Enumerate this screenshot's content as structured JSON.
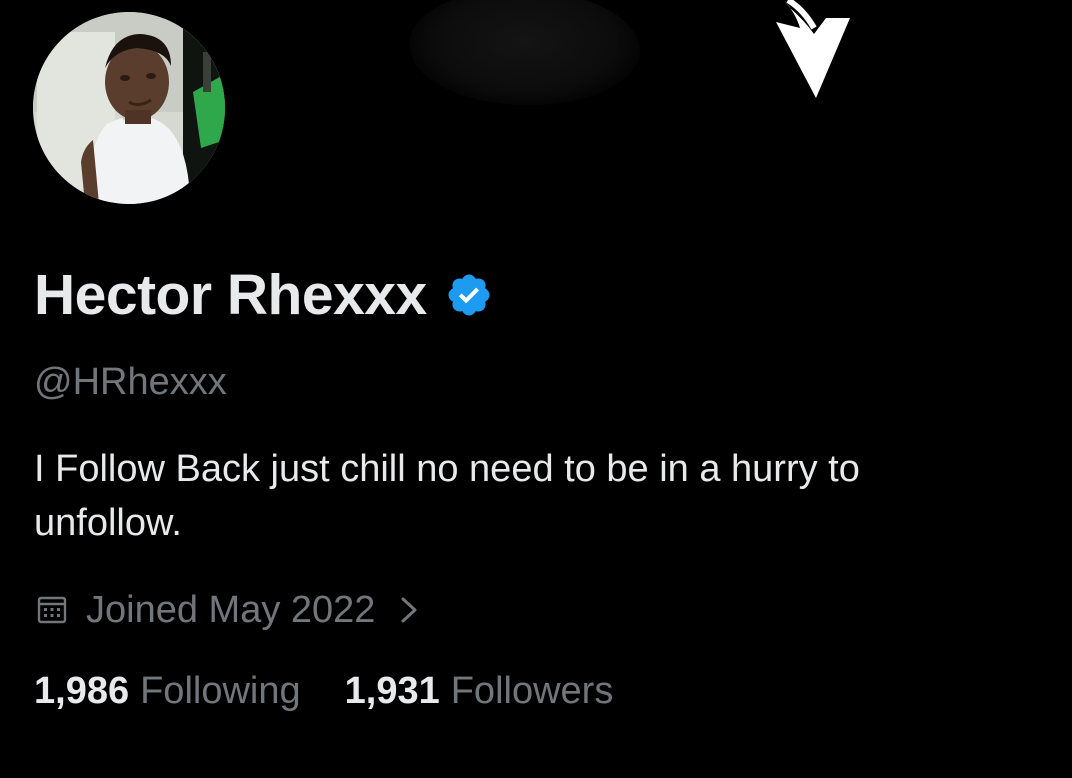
{
  "profile": {
    "display_name": "Hector Rhexxx",
    "handle": "@HRhexxx",
    "bio": "I Follow Back just chill no need to be in a hurry to unfollow.",
    "verified": true,
    "verified_color": "#1d9bf0"
  },
  "joined": {
    "text": "Joined May 2022",
    "icon": "calendar-icon",
    "chevron_icon": "chevron-right-icon"
  },
  "stats": {
    "following_count": "1,986",
    "following_label": "Following",
    "followers_count": "1,931",
    "followers_label": "Followers"
  },
  "banner": {
    "arrow_icon": "arrow-down-icon"
  },
  "colors": {
    "background": "#000000",
    "primary_text": "#e7e9ea",
    "secondary_text": "#71767b",
    "accent": "#1d9bf0"
  }
}
